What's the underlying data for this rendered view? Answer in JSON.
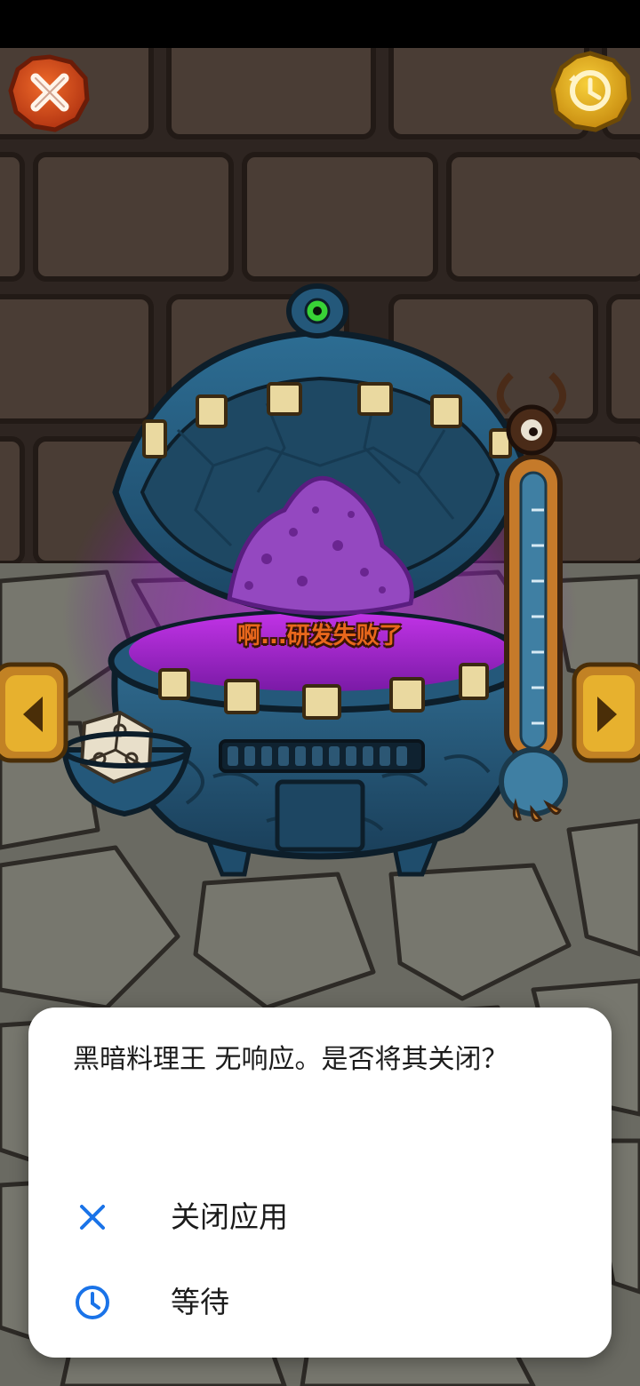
{
  "game": {
    "result_message": "啊...研发失败了",
    "close_icon": "close-x-icon",
    "history_icon": "history-clock-icon",
    "prev_icon": "arrow-left-icon",
    "next_icon": "arrow-right-icon"
  },
  "dialog": {
    "message": "黑暗料理王 无响应。是否将其关闭？",
    "actions": [
      {
        "label": "关闭应用",
        "icon": "close-icon"
      },
      {
        "label": "等待",
        "icon": "clock-icon"
      }
    ],
    "accent_color": "#1a73e8"
  }
}
